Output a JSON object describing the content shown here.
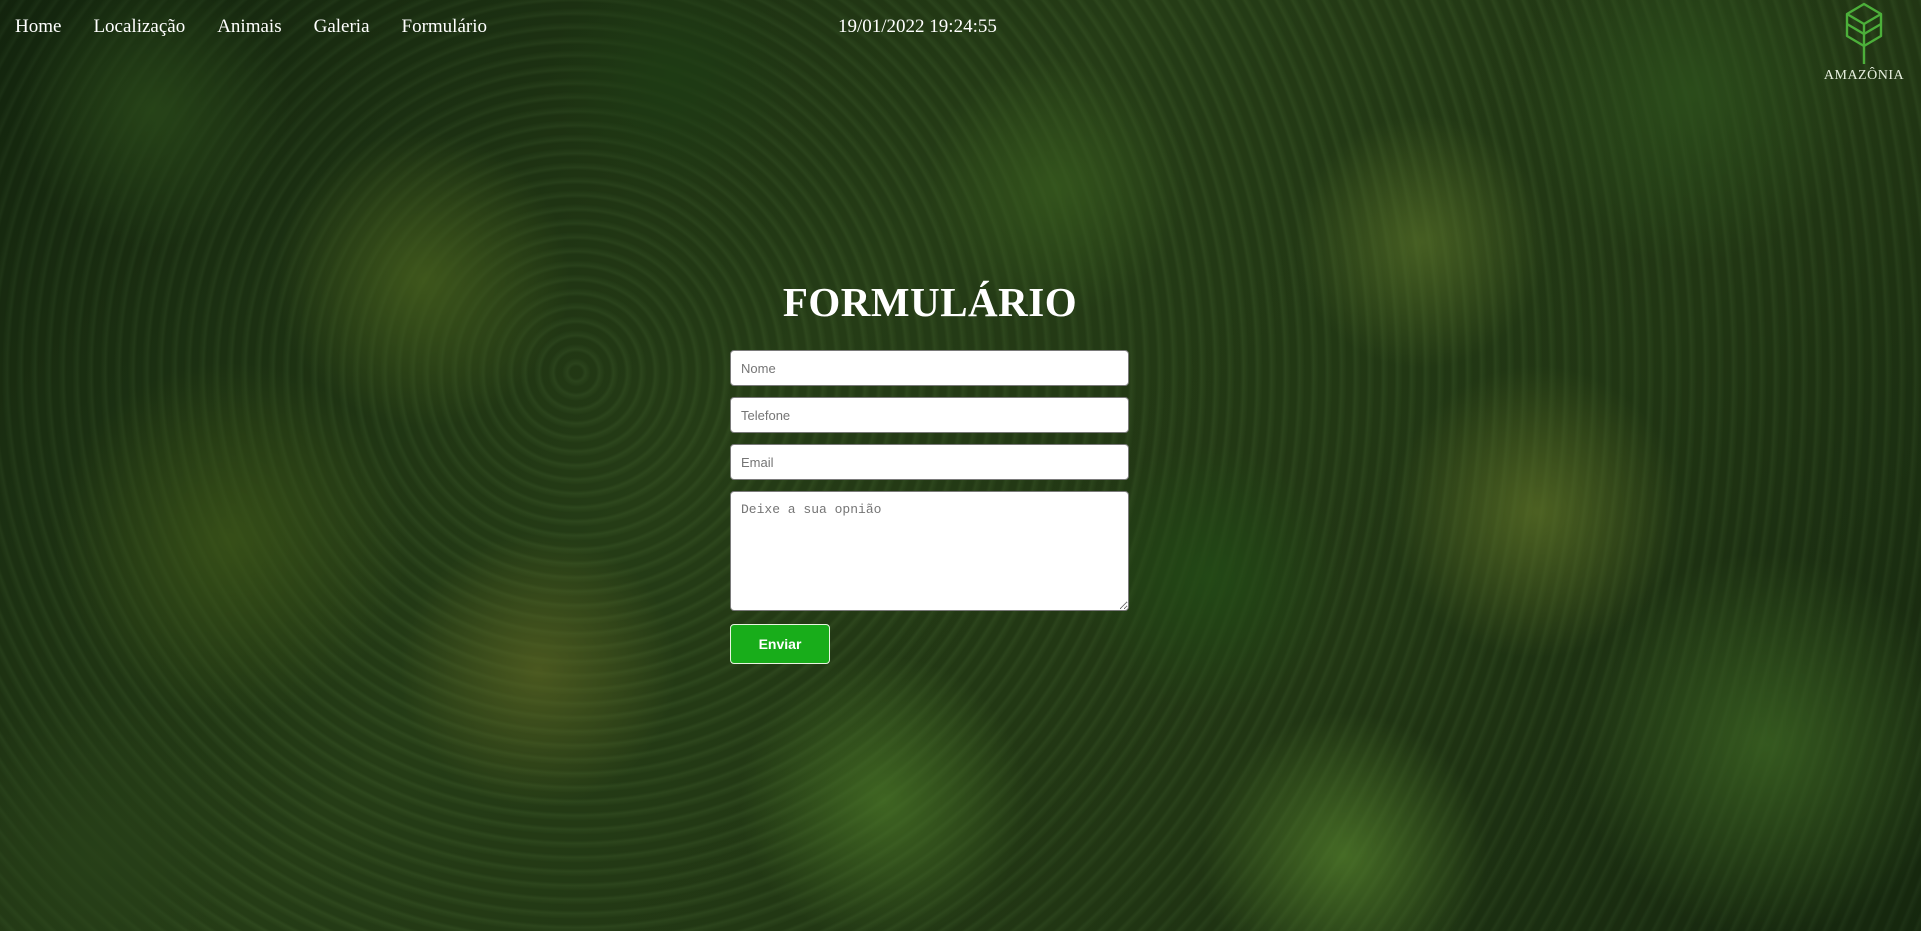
{
  "nav": {
    "items": [
      {
        "label": "Home"
      },
      {
        "label": "Localização"
      },
      {
        "label": "Animais"
      },
      {
        "label": "Galeria"
      },
      {
        "label": "Formulário"
      }
    ]
  },
  "clock": {
    "text": "19/01/2022 19:24:55"
  },
  "logo": {
    "text": "AMAZÔNIA",
    "icon": "cube-tree-icon",
    "color": "#4caf3a"
  },
  "form": {
    "title": "FORMULÁRIO",
    "name_placeholder": "Nome",
    "phone_placeholder": "Telefone",
    "email_placeholder": "Email",
    "opinion_placeholder": "Deixe a sua opnião",
    "submit_label": "Enviar",
    "submit_color": "#18ad1a"
  }
}
